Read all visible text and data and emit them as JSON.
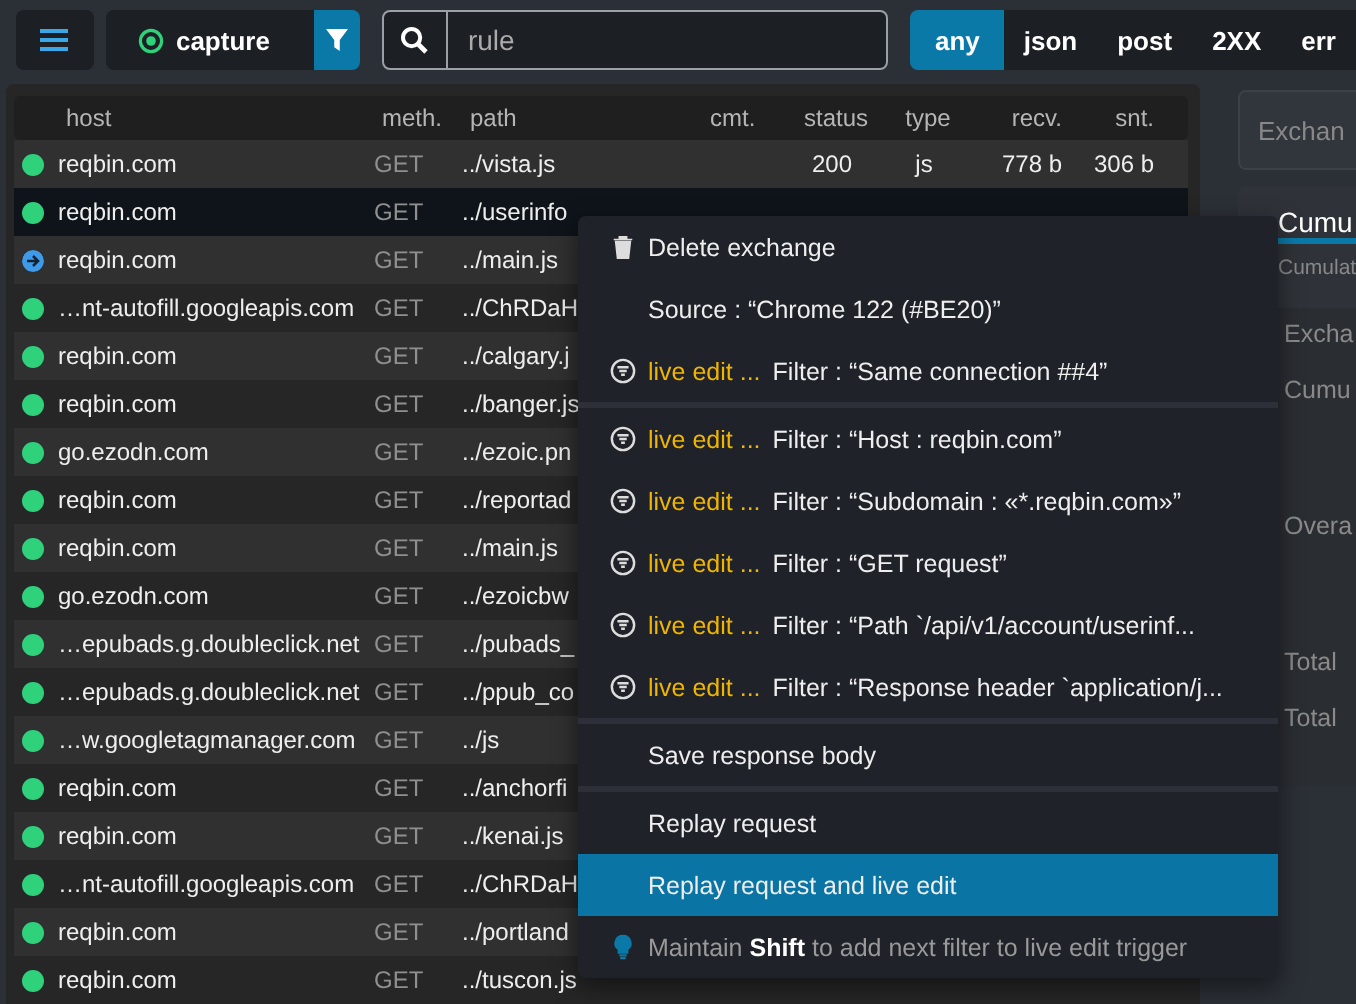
{
  "toolbar": {
    "capture": {
      "label": "capture",
      "on": true
    },
    "search": {
      "value": "rule"
    },
    "chips": [
      {
        "label": "any",
        "selected": true
      },
      {
        "label": "json",
        "selected": false
      },
      {
        "label": "post",
        "selected": false
      },
      {
        "label": "2XX",
        "selected": false
      },
      {
        "label": "err",
        "selected": false
      }
    ]
  },
  "table": {
    "columns": [
      "host",
      "meth.",
      "path",
      "cmt.",
      "status",
      "type",
      "recv.",
      "snt."
    ],
    "rows": [
      {
        "kind": "done",
        "selected": false,
        "cells": [
          "reqbin.com",
          "GET",
          "../vista.js",
          "",
          "200",
          "js",
          "778 b",
          "306 b"
        ]
      },
      {
        "kind": "done",
        "selected": true,
        "cells": [
          "reqbin.com",
          "GET",
          "../userinfo"
        ]
      },
      {
        "kind": "pending",
        "selected": false,
        "cells": [
          "reqbin.com",
          "GET",
          "../main.js"
        ]
      },
      {
        "kind": "done",
        "selected": false,
        "cells": [
          "…nt-autofill.googleapis.com",
          "GET",
          "../ChRDaH"
        ]
      },
      {
        "kind": "done",
        "selected": false,
        "cells": [
          "reqbin.com",
          "GET",
          "../calgary.j"
        ]
      },
      {
        "kind": "done",
        "selected": false,
        "cells": [
          "reqbin.com",
          "GET",
          "../banger.js"
        ]
      },
      {
        "kind": "done",
        "selected": false,
        "cells": [
          "go.ezodn.com",
          "GET",
          "../ezoic.pn"
        ]
      },
      {
        "kind": "done",
        "selected": false,
        "cells": [
          "reqbin.com",
          "GET",
          "../reportad"
        ]
      },
      {
        "kind": "done",
        "selected": false,
        "cells": [
          "reqbin.com",
          "GET",
          "../main.js"
        ]
      },
      {
        "kind": "done",
        "selected": false,
        "cells": [
          "go.ezodn.com",
          "GET",
          "../ezoicbw"
        ]
      },
      {
        "kind": "done",
        "selected": false,
        "cells": [
          "…epubads.g.doubleclick.net",
          "GET",
          "../pubads_"
        ]
      },
      {
        "kind": "done",
        "selected": false,
        "cells": [
          "…epubads.g.doubleclick.net",
          "GET",
          "../ppub_co"
        ]
      },
      {
        "kind": "done",
        "selected": false,
        "cells": [
          "…w.googletagmanager.com",
          "GET",
          "../js"
        ]
      },
      {
        "kind": "done",
        "selected": false,
        "cells": [
          "reqbin.com",
          "GET",
          "../anchorfi"
        ]
      },
      {
        "kind": "done",
        "selected": false,
        "cells": [
          "reqbin.com",
          "GET",
          "../kenai.js"
        ]
      },
      {
        "kind": "done",
        "selected": false,
        "cells": [
          "…nt-autofill.googleapis.com",
          "GET",
          "../ChRDaH"
        ]
      },
      {
        "kind": "done",
        "selected": false,
        "cells": [
          "reqbin.com",
          "GET",
          "../portland"
        ]
      },
      {
        "kind": "done",
        "selected": false,
        "cells": [
          "reqbin.com",
          "GET",
          "../tuscon.js"
        ]
      }
    ]
  },
  "side_panel": {
    "field": {
      "placeholder": "Exchan"
    },
    "tab": "Cumu",
    "subtitle": "Cumulat",
    "labels": [
      "Excha",
      "Cumu",
      "Overa",
      "Total",
      "Total"
    ]
  },
  "context_menu": {
    "groups": [
      [
        {
          "kind": "delete",
          "label": "Delete exchange",
          "selected": false
        },
        {
          "kind": "plain",
          "label": "Source : “Chrome 122 (#BE20)”",
          "selected": false
        },
        {
          "kind": "filter",
          "prefix": "live edit ...",
          "label": "Filter : “Same connection ##4”",
          "selected": false
        }
      ],
      [
        {
          "kind": "filter",
          "prefix": "live edit ...",
          "label": "Filter : “Host : reqbin.com”",
          "selected": false
        },
        {
          "kind": "filter",
          "prefix": "live edit ...",
          "label": "Filter : “Subdomain : «*.reqbin.com»”",
          "selected": false
        },
        {
          "kind": "filter",
          "prefix": "live edit ...",
          "label": "Filter : “GET request”",
          "selected": false
        },
        {
          "kind": "filter",
          "prefix": "live edit ...",
          "label": "Filter : “Path `/api/v1/account/userinf...",
          "selected": false
        },
        {
          "kind": "filter",
          "prefix": "live edit ...",
          "label": "Filter : “Response header `application/j...",
          "selected": false
        }
      ],
      [
        {
          "kind": "plain",
          "label": "Save response body",
          "selected": false
        }
      ],
      [
        {
          "kind": "plain",
          "label": "Replay request",
          "selected": false
        },
        {
          "kind": "plain",
          "label": "Replay request and live edit",
          "selected": true
        },
        {
          "kind": "hint",
          "label": "Maintain **Shift** to add next filter to live edit trigger",
          "selected": false
        }
      ]
    ]
  }
}
